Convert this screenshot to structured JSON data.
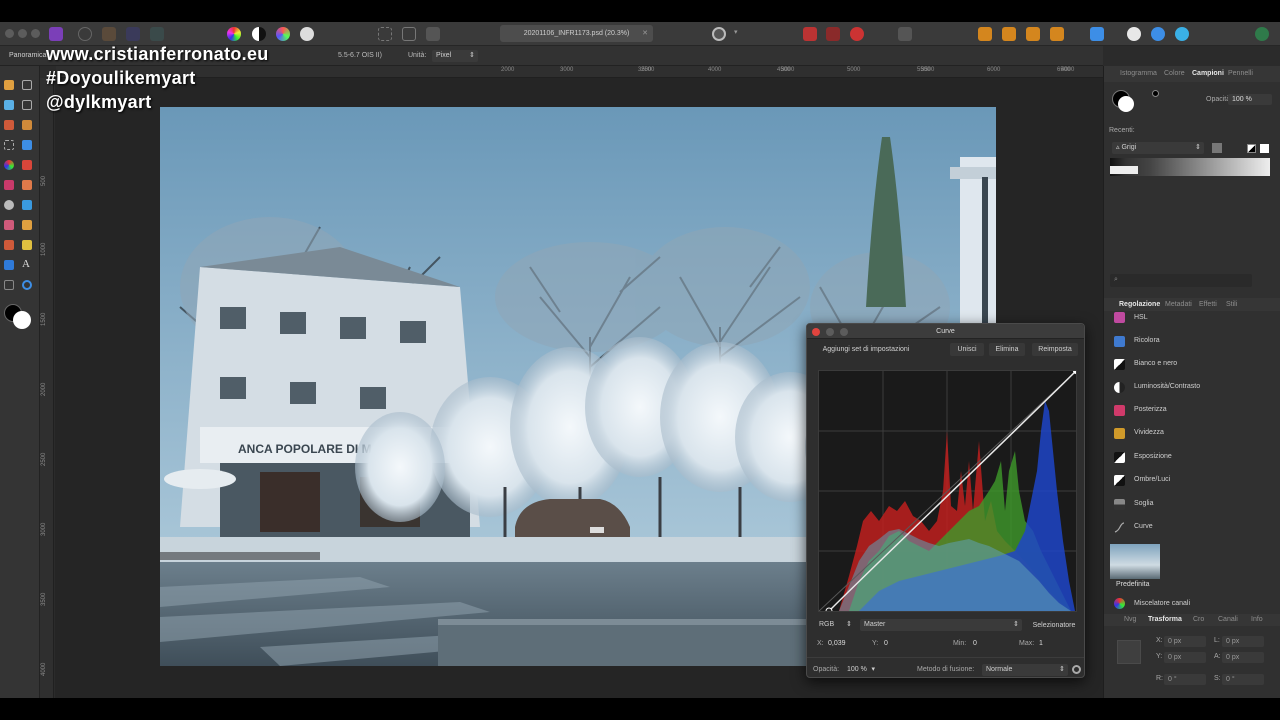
{
  "watermark": {
    "line1": "www.cristianferronato.eu",
    "line2": "#Doyoulikemyart",
    "line3": "@dylkmyart"
  },
  "document": {
    "tab_label": "20201106_INFR1173.psd (20.3%)"
  },
  "context_bar": {
    "tool_name": "Panoramica",
    "lens": "5.5-6.7 OIS II)",
    "units_label": "Unità:",
    "units_value": "Pixel"
  },
  "ruler": {
    "top_ticks": [
      "2000",
      "2500",
      "3000",
      "3500",
      "4000",
      "4500",
      "5000",
      "5500",
      "6000",
      "6500"
    ],
    "left_ticks": [
      "500",
      "1000",
      "1500",
      "2000",
      "2500",
      "3000",
      "3500",
      "4000"
    ]
  },
  "photo": {
    "sign_text": "ANCA POPOLARE DI MAROS"
  },
  "right_panel": {
    "top_tabs": [
      "Istogramma",
      "Colore",
      "Campioni",
      "Pennelli"
    ],
    "active_top_tab": "Campioni",
    "opacity_label": "Opacità:",
    "opacity_value": "100 %",
    "recent_label": "Recenti:",
    "palette_value": "Grigi",
    "adj_tabs": [
      "Regolazione",
      "Metadati",
      "Effetti",
      "Stili"
    ],
    "adjustments": [
      {
        "label": "HSL",
        "color": "#c04aa0"
      },
      {
        "label": "Ricolora",
        "color": "#3f7ad0"
      },
      {
        "label": "Bianco e nero",
        "color": "#e0e0e0"
      },
      {
        "label": "Luminosità/Contrasto",
        "color": "#e0e0e0"
      },
      {
        "label": "Posterizza",
        "color": "#d03a6a"
      },
      {
        "label": "Vividezza",
        "color": "#d09a2a"
      },
      {
        "label": "Esposizione",
        "color": "#e0e0e0"
      },
      {
        "label": "Ombre/Luci",
        "color": "#e0e0e0"
      },
      {
        "label": "Soglia",
        "color": "#9a9a9a"
      },
      {
        "label": "Curve",
        "color": "#9a9a9a"
      }
    ],
    "preset_label": "Predefinita",
    "channel_mixer_label": "Miscelatore canali",
    "bottom_tabs": [
      "Nvg",
      "Trasforma",
      "Cro",
      "Canali",
      "Info"
    ],
    "active_bottom_tab": "Trasforma",
    "transform": {
      "x_label": "X:",
      "x_value": "0 px",
      "y_label": "Y:",
      "y_value": "0 px",
      "l_label": "L:",
      "l_value": "0 px",
      "a_label": "A:",
      "a_value": "0 px",
      "r_label": "R:",
      "r_value": "0 °",
      "s_label": "S:",
      "s_value": "0 °"
    }
  },
  "curves_dialog": {
    "title": "Curve",
    "add_preset": "Aggiungi set di impostazioni",
    "merge": "Unisci",
    "delete": "Elimina",
    "reset": "Reimposta",
    "color_space": "RGB",
    "channel": "Master",
    "picker": "Selezionatore",
    "x_label": "X:",
    "x_value": "0,039",
    "y_label": "Y:",
    "y_value": "0",
    "min_label": "Min:",
    "min_value": "0",
    "max_label": "Max:",
    "max_value": "1",
    "opacity_label": "Opacità:",
    "opacity_value": "100 %",
    "blend_label": "Metodo di fusione:",
    "blend_value": "Normale"
  },
  "colors": {
    "accent": "#3d8ee6",
    "red_channel": "#c0201e",
    "green_channel": "#3e9a2a",
    "blue_channel": "#1f45c8"
  }
}
